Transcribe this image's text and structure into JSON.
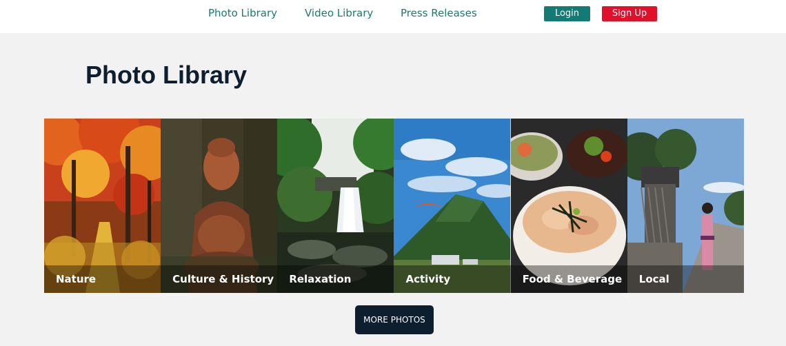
{
  "nav": {
    "links": [
      {
        "label": "Photo Library"
      },
      {
        "label": "Video Library"
      },
      {
        "label": "Press Releases"
      }
    ],
    "login_label": "Login",
    "signup_label": "Sign Up"
  },
  "main": {
    "title": "Photo Library",
    "categories": [
      {
        "label": "Nature",
        "icon": "autumn-forest-photo"
      },
      {
        "label": "Culture & History",
        "icon": "stone-buddha-photo"
      },
      {
        "label": "Relaxation",
        "icon": "waterfall-photo"
      },
      {
        "label": "Activity",
        "icon": "paraglider-mountain-photo"
      },
      {
        "label": "Food & Beverage",
        "icon": "food-bowls-photo"
      },
      {
        "label": "Local",
        "icon": "kimono-street-photo"
      }
    ],
    "more_label": "MORE PHOTOS"
  },
  "colors": {
    "accent": "#147a76",
    "signup": "#e0112b",
    "dark": "#0d1e2e",
    "background": "#f2f2f2"
  }
}
